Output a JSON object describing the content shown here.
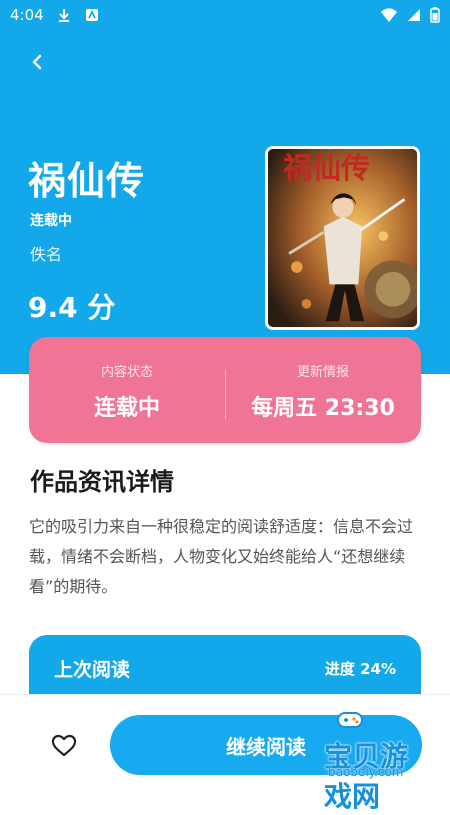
{
  "status_bar": {
    "time": "4:04"
  },
  "book": {
    "title": "祸仙传",
    "status": "连载中",
    "author": "佚名",
    "score": "9.4 分",
    "cover_title": "祸仙传"
  },
  "info_card": {
    "content_status_label": "内容状态",
    "content_status_value": "连载中",
    "update_label": "更新情报",
    "update_value": "每周五 23:30"
  },
  "details": {
    "section_title": "作品资讯详情",
    "description": "它的吸引力来自一种很稳定的阅读舒适度：信息不会过载，情绪不会断档，人物变化又始终能给人“还想继续看”的期待。"
  },
  "last_read": {
    "title": "上次阅读",
    "progress_label": "进度 24%",
    "progress_value": 24
  },
  "bottom_bar": {
    "continue_label": "继续阅读"
  },
  "watermark": {
    "text": "宝贝游戏网",
    "url": "baobeiy.com"
  },
  "colors": {
    "primary": "#12a8ea",
    "card_pink": "#f07595",
    "text_dark": "#1b1b1b",
    "text_muted": "#555555"
  },
  "icons": {
    "back": "chevron-left-icon",
    "download": "download-icon",
    "app": "app-icon",
    "wifi": "wifi-icon",
    "signal": "signal-icon",
    "battery": "battery-icon",
    "favorite": "heart-icon"
  }
}
